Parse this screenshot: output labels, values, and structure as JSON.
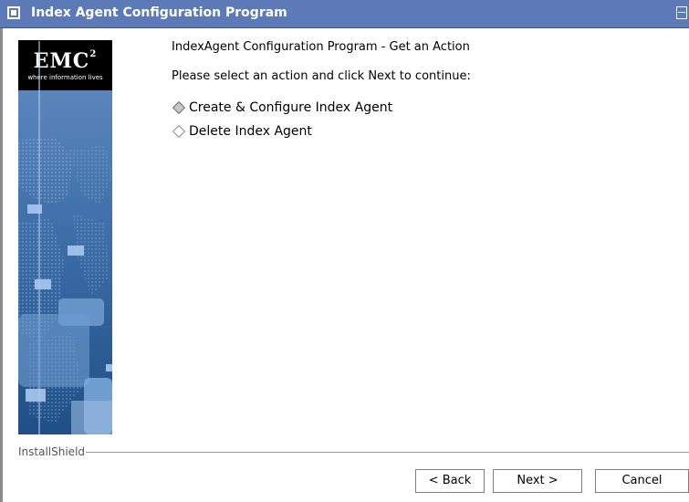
{
  "window": {
    "title": "Index Agent Configuration Program"
  },
  "brand": {
    "logo_text": "EMC",
    "logo_sup": "2",
    "tagline": "where information lives"
  },
  "content": {
    "heading": "IndexAgent Configuration Program - Get an Action",
    "instruction": "Please select an action and click Next to continue:",
    "options": [
      {
        "label": "Create & Configure Index Agent",
        "selected": true
      },
      {
        "label": "Delete Index Agent",
        "selected": false
      }
    ]
  },
  "footer": {
    "brand": "InstallShield",
    "buttons": {
      "back": "< Back",
      "next": "Next >",
      "cancel": "Cancel"
    }
  }
}
